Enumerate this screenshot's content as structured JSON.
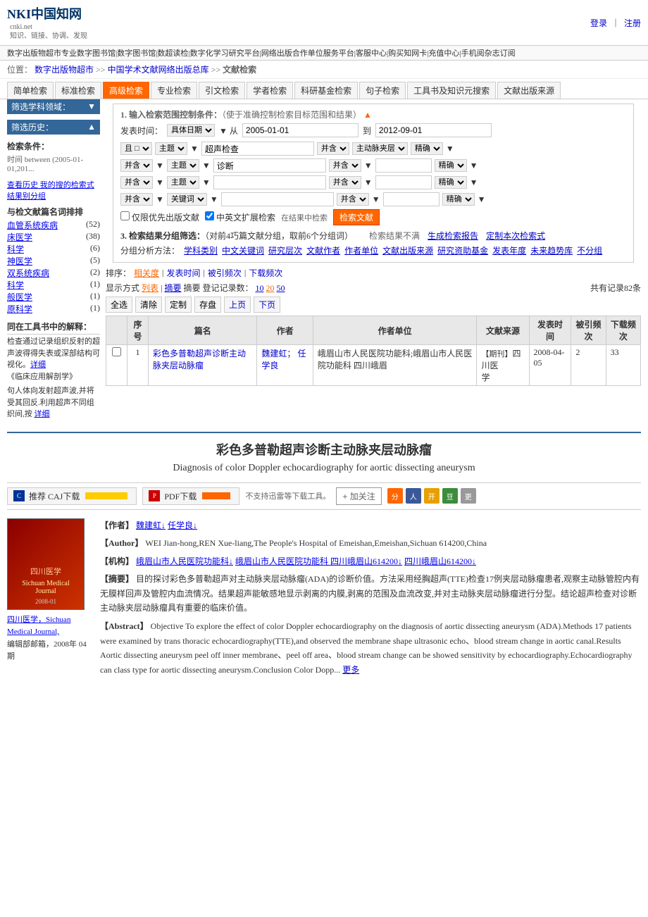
{
  "header": {
    "logo": "NKI中国知网",
    "logo_sub": "cnki.net\n知识、链接、协调、发现",
    "auth_login": "登录",
    "auth_register": "注册",
    "nav_links": [
      "数字出版物超市专业数字图书馆",
      "数字图书馆",
      "数超读检",
      "数字化学习研究平台",
      "网络出版合作单位服务平台",
      "客服中心",
      "购买知网卡",
      "充值中心",
      "手机阅杂志订阅"
    ]
  },
  "breadcrumb": {
    "text": "位置：数字出版物超市 >> 中国学术文献网络出版总库 >> 文献检索",
    "parts": [
      "数字出版物超市",
      "中国学术文献网络出版总库",
      "文献检索"
    ]
  },
  "search_tabs": [
    "简单检索",
    "标准检索",
    "高级检索",
    "专业检索",
    "引文检索",
    "学者检索",
    "科研基金检索",
    "句子检索",
    "工具书及知识元搜索",
    "文献出版来源"
  ],
  "active_tab": "高级检索",
  "search": {
    "note": "1. 输入检索范围控制条件：（使于准确控制检索目标范围和结果）",
    "date_label": "发表时间：",
    "date_type": "具体日期",
    "date_from": "2005-01-01",
    "date_to": "2012-09-01",
    "rows": [
      {
        "join": "且",
        "field": "主题",
        "value": "超声检查",
        "join2": "并含",
        "field2": "主动脉夹层",
        "precision": "精确"
      },
      {
        "join": "并含",
        "field": "主题",
        "value": "诊断",
        "join2": "并含",
        "precision": "精确"
      },
      {
        "join": "并含",
        "field": "主题",
        "value": "",
        "join2": "并含",
        "precision": "精确"
      },
      {
        "join": "并含",
        "field": "关键词",
        "value": "",
        "join2": "并含",
        "precision": "精确"
      }
    ],
    "only_best": "仅限优先出版文献",
    "expand": "中英文扩展检索",
    "search_btn": "检索文献",
    "step3_label": "3. 检索结果分组筛选：（对前4巧篇文献分组，取前6个分组词）",
    "result_not_satisfied": "检索结果不满",
    "bio_report": "生成检索报告",
    "custom": "定制本次检索式",
    "filter_method": "分组分析方法：",
    "filter_tabs": [
      "学科类别",
      "中文关键词",
      "研究层次",
      "文献作者",
      "作者单位",
      "文献出版来源",
      "研究资助基金",
      "发表年度",
      "未来趋势库",
      "不分组"
    ]
  },
  "sidebar": {
    "filter_title": "筛选学科领域：",
    "filter_arrow": "▼",
    "history_title": "筛选历史：",
    "history_arrow": "▲",
    "conditions_title": "检索条件：",
    "time_range": "时间 between (2005-01-01,201...",
    "history_links": [
      "查看历史 我的搜的检索式",
      "结果别分组"
    ],
    "ranking_title": "与检文献篇名词排排",
    "diseases": [
      {
        "name": "血管系统疾病",
        "count": 52
      },
      {
        "name": "床医学",
        "count": 38
      },
      {
        "name": "科学",
        "count": 6
      },
      {
        "name": "神医学",
        "count": 5
      },
      {
        "name": "双系统疾病",
        "count": 2
      },
      {
        "name": "科学",
        "count": 1
      },
      {
        "name": "般医学",
        "count": 1
      },
      {
        "name": "原科学",
        "count": 1
      }
    ],
    "tool_title": "同在工具书中的解释：",
    "tool_text": "检查通过记录组织反射的超声波得得失表或深部结构可视化。详细\n《临床应用解剖学》",
    "tool_text2": "句人体向发射超声波,并将受其回反.利用超声不同组织间,按 详细"
  },
  "result": {
    "sort_label": "排序：",
    "sort_options": [
      "相关度",
      "发表时间",
      "被引频次",
      "下载频次"
    ],
    "active_sort": "相关度",
    "display_label": "显示方式",
    "display_options": [
      "列表",
      "摘要"
    ],
    "active_display": "列表",
    "page_label": "摘要 登记记录数：",
    "page_options": [
      "10",
      "20",
      "50"
    ],
    "total": "共有记录82条",
    "actions": [
      "全选",
      "清除",
      "定制",
      "存盘",
      "上页",
      "下页"
    ],
    "columns": [
      "序号",
      "篇名",
      "作者",
      "作者单位",
      "文献来源",
      "发表时间",
      "被引频次",
      "下载频次"
    ],
    "rows": [
      {
        "num": 1,
        "title": "彩色多普勒超声诊断主动脉夹层动脉瘤",
        "authors": "魏建虹；任学良",
        "unit": "峨眉山市人民医院功能科;峨眉山市人民医院功能科 四川峨眉",
        "source": "【期刊】四川医学",
        "date": "2008-04-05",
        "cited": 2,
        "downloaded": 33
      }
    ]
  },
  "article": {
    "title_cn": "彩色多普勒超声诊断主动脉夹层动脉瘤",
    "title_en": "Diagnosis of color Doppler echocardiography for aortic dissecting aneurysm",
    "caj_label": "推荐 CAJ下载",
    "pdf_label": "PDF下载",
    "not_support": "不支持迅雷等下载工具。",
    "follow_btn": "+ 加关注",
    "share_icons": [
      "分享",
      "人人",
      "开心",
      "豆瓣",
      "更多"
    ],
    "authors_label": "【作者】",
    "authors": "魏建虹↓  任学良↓",
    "authors_en_label": "【Author】",
    "authors_en": "WEI Jian-hong,REN Xue-liang,The People's Hospital of Emeishan,Emeishan,Sichuan 614200,China",
    "unit_label": "【机构】",
    "unit": "峨眉山市人民医院功能科↓  峨眉山市人民医院功能科 四川峨眉山614200↓  四川峨眉山614200↓",
    "abstract_label": "【摘要】",
    "abstract": "目的探讨彩色多普勒超声对主动脉夹层动脉瘤(ADA)的诊断价值。方法采用经胸超声(TTE)检查17例夹层动脉瘤患者,观察主动脉管腔内有无膜样回声及管腔内血流情况。结果超声能敏感地显示剥离的内膜,剥离的范围及血流改变,并对主动脉夹层动脉瘤进行分型。结论超声检查对诊断主动脉夹层动脉瘤具有重要的临床价值。",
    "abstract_en_label": "【Abstract】",
    "abstract_en": "Objective To explore the effect of color Doppler echocardiography on the diagnosis of aortic dissecting aneurysm (ADA).Methods 17 patients were examined by trans thoracic echocardiography(TTE),and observed the membrane shape ultrasonic echo、blood stream change in aortic canal.Results Aortic dissecting aneurysm peel off inner membrane、peel off area、blood stream change can be showed sensitivity by echocardiography.Echocardiography can class type for aortic dissecting aneurysm.Conclusion Color Dopp...",
    "more": "更多",
    "journal_name": "四川医学，Sichuan Medical Journal,",
    "journal_issue": "编辑部邮箱，2008年 04期"
  }
}
